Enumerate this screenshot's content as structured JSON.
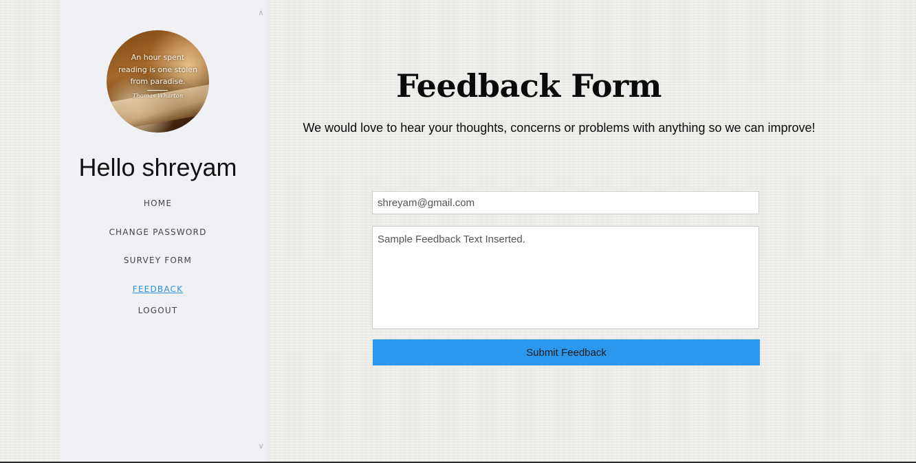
{
  "sidebar": {
    "avatar": {
      "quote_lines": [
        "An hour spent",
        "reading is one stolen",
        "from paradise."
      ],
      "author": "Thomas Wharton"
    },
    "greeting": "Hello shreyam",
    "nav": {
      "home": "HOME",
      "change_password": "CHANGE PASSWORD",
      "survey_form": "SURVEY FORM",
      "feedback": "FEEDBACK",
      "logout": "LOGOUT"
    },
    "scroll_up_icon": "chevron-up-icon",
    "scroll_down_icon": "chevron-down-icon"
  },
  "main": {
    "title": "Feedback Form",
    "subtitle": "We would love to hear your thoughts, concerns or problems with anything so we can improve!",
    "form": {
      "email_value": "shreyam@gmail.com",
      "feedback_value": "Sample Feedback Text Inserted.",
      "submit_label": "Submit Feedback"
    }
  },
  "colors": {
    "accent": "#2b98ee",
    "active_link": "#2d8fd5",
    "sidebar_bg": "#f0f1f5",
    "page_bg": "#ecebe8"
  }
}
